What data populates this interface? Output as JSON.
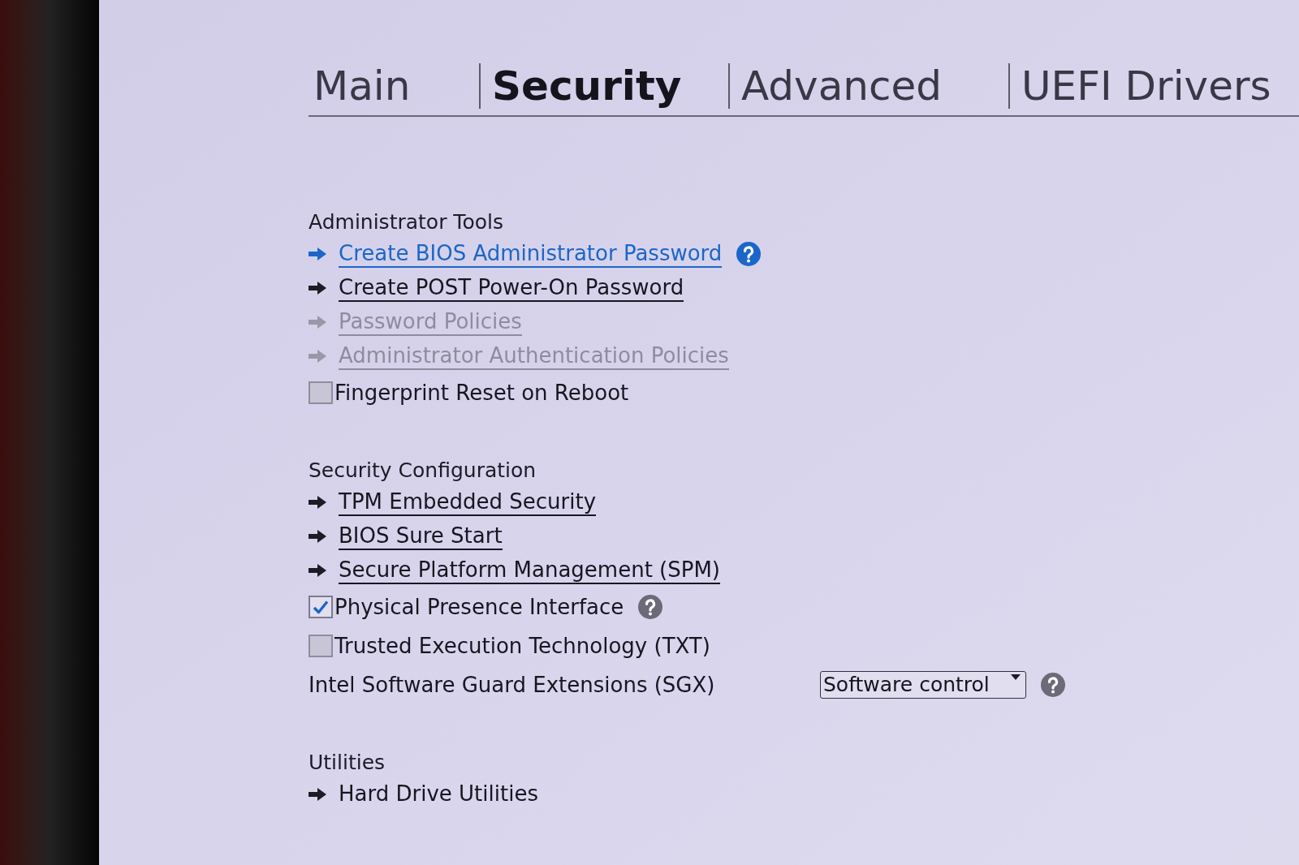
{
  "tabs": [
    {
      "label": "Main",
      "selected": false
    },
    {
      "label": "Security",
      "selected": true
    },
    {
      "label": "Advanced",
      "selected": false
    },
    {
      "label": "UEFI Drivers",
      "selected": false
    }
  ],
  "sections": [
    {
      "title": "Administrator Tools",
      "items": [
        {
          "kind": "link",
          "label": "Create BIOS Administrator Password",
          "selected": true,
          "disabled": false,
          "underlined": true,
          "help": true
        },
        {
          "kind": "link",
          "label": "Create POST Power-On Password",
          "selected": false,
          "disabled": false,
          "underlined": true,
          "help": false
        },
        {
          "kind": "link",
          "label": "Password Policies",
          "selected": false,
          "disabled": true,
          "underlined": true,
          "help": false
        },
        {
          "kind": "link",
          "label": "Administrator Authentication Policies",
          "selected": false,
          "disabled": true,
          "underlined": true,
          "help": false
        },
        {
          "kind": "checkbox",
          "label": "Fingerprint Reset on Reboot",
          "selected": false,
          "disabled": false,
          "checked": false,
          "help": false
        }
      ]
    },
    {
      "title": "Security Configuration",
      "items": [
        {
          "kind": "link",
          "label": "TPM Embedded Security",
          "selected": false,
          "disabled": false,
          "underlined": true,
          "help": false
        },
        {
          "kind": "link",
          "label": "BIOS Sure Start",
          "selected": false,
          "disabled": false,
          "underlined": true,
          "help": false
        },
        {
          "kind": "link",
          "label": "Secure Platform Management (SPM)",
          "selected": false,
          "disabled": false,
          "underlined": true,
          "help": false
        },
        {
          "kind": "checkbox",
          "label": "Physical Presence Interface",
          "selected": false,
          "disabled": false,
          "checked": true,
          "help": true
        },
        {
          "kind": "checkbox",
          "label": "Trusted Execution Technology (TXT)",
          "selected": false,
          "disabled": false,
          "checked": false,
          "help": false
        },
        {
          "kind": "select",
          "label": "Intel Software Guard Extensions (SGX)",
          "value": "Software control",
          "selected": false,
          "disabled": false,
          "help": true
        }
      ]
    },
    {
      "title": "Utilities",
      "items": [
        {
          "kind": "link",
          "label": "Hard Drive Utilities",
          "selected": false,
          "disabled": false,
          "underlined": false,
          "help": false
        }
      ]
    }
  ]
}
